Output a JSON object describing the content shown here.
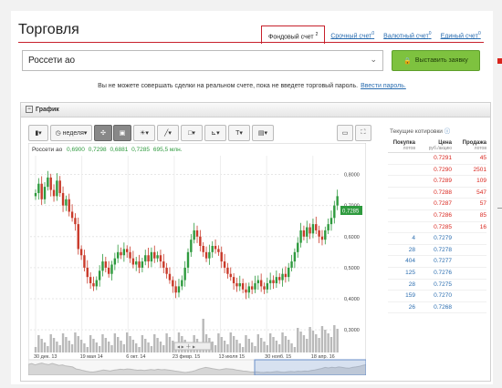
{
  "page_title": "Торговля",
  "tabs": [
    {
      "label": "Фондовый счет",
      "sup": "2",
      "active": true
    },
    {
      "label": "Срочный счет",
      "sup": "0"
    },
    {
      "label": "Валютный счет",
      "sup": "0"
    },
    {
      "label": "Единый счет",
      "sup": "0"
    }
  ],
  "instrument": "Россети ао",
  "order_button": "Выставить заявку",
  "notice": "Вы не можете совершать сделки на реальном счете, пока не введете торговый пароль.",
  "notice_link": "Ввести пароль.",
  "chart_panel": {
    "title": "График",
    "period": "неделя",
    "legend": {
      "name": "Россети ао",
      "o": "0,6900",
      "h": "0,7298",
      "l": "0,6881",
      "c": "0,7285",
      "v": "695,5 млн."
    }
  },
  "chart_data": {
    "type": "candlestick",
    "xlabels": [
      "30 дек. 13",
      "19 мая 14",
      "6 окт. 14",
      "23 февр. 15",
      "13 июля 15",
      "30 нояб. 15",
      "18 апр. 16"
    ],
    "yticks": [
      "0,8000",
      "0,7000",
      "0,6000",
      "0,5000",
      "0,4000",
      "0,3000"
    ],
    "ylim": [
      0.28,
      0.86
    ],
    "last_price": "0,7285",
    "closes": [
      0.74,
      0.77,
      0.72,
      0.76,
      0.79,
      0.75,
      0.73,
      0.78,
      0.74,
      0.7,
      0.72,
      0.68,
      0.66,
      0.64,
      0.56,
      0.54,
      0.5,
      0.47,
      0.45,
      0.44,
      0.46,
      0.49,
      0.52,
      0.5,
      0.48,
      0.51,
      0.53,
      0.55,
      0.54,
      0.56,
      0.55,
      0.53,
      0.51,
      0.52,
      0.5,
      0.52,
      0.54,
      0.52,
      0.55,
      0.53,
      0.54,
      0.52,
      0.5,
      0.48,
      0.46,
      0.44,
      0.42,
      0.44,
      0.46,
      0.5,
      0.55,
      0.59,
      0.62,
      0.6,
      0.57,
      0.55,
      0.53,
      0.55,
      0.57,
      0.56,
      0.55,
      0.52,
      0.5,
      0.48,
      0.47,
      0.45,
      0.44,
      0.45,
      0.43,
      0.42,
      0.44,
      0.43,
      0.45,
      0.46,
      0.44,
      0.43,
      0.45,
      0.46,
      0.45,
      0.47,
      0.46,
      0.48,
      0.47,
      0.5,
      0.52,
      0.55,
      0.58,
      0.62,
      0.6,
      0.63,
      0.61,
      0.64,
      0.62,
      0.6,
      0.59,
      0.62,
      0.64,
      0.66,
      0.7,
      0.73
    ]
  },
  "quotes": {
    "title": "Текущие котировки",
    "headers": [
      "Покупка",
      "Цена",
      "Продажа"
    ],
    "subheaders": [
      "лотов",
      "руб./акцию",
      "лотов"
    ],
    "rows": [
      {
        "buy": "",
        "price": "0.7291",
        "sell": "45",
        "side": "sell"
      },
      {
        "buy": "",
        "price": "0.7290",
        "sell": "2501",
        "side": "sell"
      },
      {
        "buy": "",
        "price": "0.7289",
        "sell": "109",
        "side": "sell"
      },
      {
        "buy": "",
        "price": "0.7288",
        "sell": "547",
        "side": "sell"
      },
      {
        "buy": "",
        "price": "0.7287",
        "sell": "57",
        "side": "sell"
      },
      {
        "buy": "",
        "price": "0.7286",
        "sell": "85",
        "side": "sell"
      },
      {
        "buy": "",
        "price": "0.7285",
        "sell": "16",
        "side": "sell"
      },
      {
        "buy": "4",
        "price": "0.7279",
        "sell": "",
        "side": "buy"
      },
      {
        "buy": "28",
        "price": "0.7278",
        "sell": "",
        "side": "buy"
      },
      {
        "buy": "404",
        "price": "0.7277",
        "sell": "",
        "side": "buy"
      },
      {
        "buy": "125",
        "price": "0.7276",
        "sell": "",
        "side": "buy"
      },
      {
        "buy": "28",
        "price": "0.7275",
        "sell": "",
        "side": "buy"
      },
      {
        "buy": "159",
        "price": "0.7270",
        "sell": "",
        "side": "buy"
      },
      {
        "buy": "26",
        "price": "0.7268",
        "sell": "",
        "side": "buy"
      }
    ]
  },
  "colors": {
    "accent": "#c7202b",
    "up": "#2e9a3e",
    "down": "#c93a2a",
    "link": "#2a6db0"
  }
}
